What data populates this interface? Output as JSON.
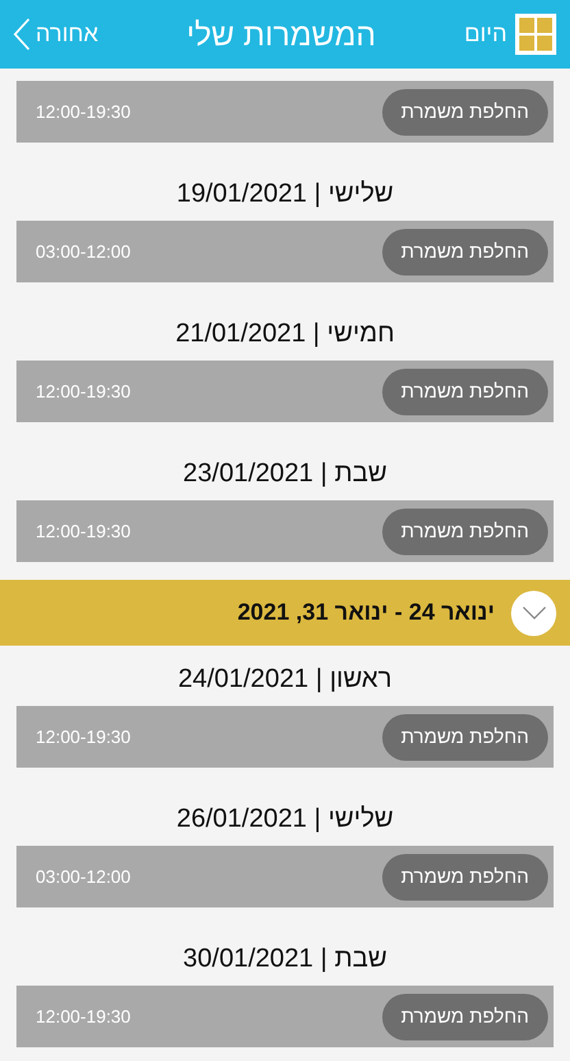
{
  "header": {
    "title": "המשמרות שלי",
    "back": "אחורה",
    "today": "היום"
  },
  "items": [
    {
      "kind": "day",
      "shifts": [
        {
          "time": "12:00-19:30",
          "button": "החלפת משמרת"
        }
      ]
    },
    {
      "kind": "day",
      "heading": "שלישי | 19/01/2021",
      "shifts": [
        {
          "time": "03:00-12:00",
          "button": "החלפת משמרת"
        }
      ]
    },
    {
      "kind": "day",
      "heading": "חמישי | 21/01/2021",
      "shifts": [
        {
          "time": "12:00-19:30",
          "button": "החלפת משמרת"
        }
      ]
    },
    {
      "kind": "day",
      "heading": "שבת | 23/01/2021",
      "shifts": [
        {
          "time": "12:00-19:30",
          "button": "החלפת משמרת"
        }
      ]
    },
    {
      "kind": "week",
      "label": "ינואר 24 - ינואר 31, 2021",
      "expanded": true
    },
    {
      "kind": "day",
      "heading": "ראשון | 24/01/2021",
      "shifts": [
        {
          "time": "12:00-19:30",
          "button": "החלפת משמרת"
        }
      ]
    },
    {
      "kind": "day",
      "heading": "שלישי | 26/01/2021",
      "shifts": [
        {
          "time": "03:00-12:00",
          "button": "החלפת משמרת"
        }
      ]
    },
    {
      "kind": "day",
      "heading": "שבת | 30/01/2021",
      "shifts": [
        {
          "time": "12:00-19:30",
          "button": "החלפת משמרת"
        }
      ]
    }
  ]
}
